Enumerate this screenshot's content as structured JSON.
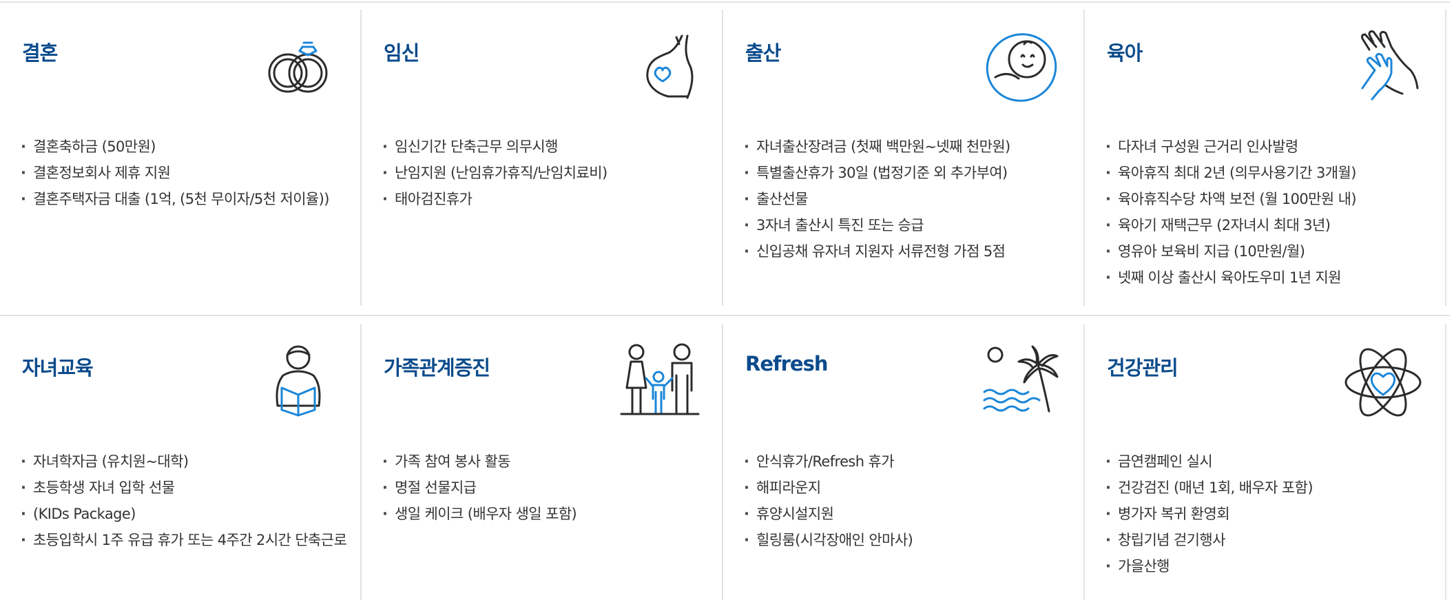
{
  "colors": {
    "title": "#0b4b8c",
    "accent": "#1a86d8",
    "icon_line": "#2b2b2b",
    "divider": "#e3e3e3"
  },
  "sections": [
    {
      "title": "결혼",
      "icon": "wedding-rings-icon",
      "items": [
        "결혼축하금 (50만원)",
        "결혼정보회사 제휴 지원",
        "결혼주택자금 대출 (1억, (5천 무이자/5천 저이율))"
      ]
    },
    {
      "title": "임신",
      "icon": "pregnancy-icon",
      "items": [
        "임신기간 단축근무 의무시행",
        "난임지원 (난임휴가휴직/난임치료비)",
        "태아검진휴가"
      ]
    },
    {
      "title": "출산",
      "icon": "newborn-baby-icon",
      "items": [
        "자녀출산장려금 (첫째 백만원~넷째 천만원)",
        "특별출산휴가 30일 (법정기준 외 추가부여)",
        "출산선물",
        "3자녀 출산시 특진 또는 승급",
        "신입공채 유자녀 지원자 서류전형 가점 5점"
      ]
    },
    {
      "title": "육아",
      "icon": "parent-child-hands-icon",
      "items": [
        "다자녀 구성원 근거리 인사발령",
        "육아휴직 최대 2년 (의무사용기간 3개월)",
        "육아휴직수당 차액 보전 (월 100만원 내)",
        "육아기 재택근무 (2자녀시 최대 3년)",
        "영유아 보육비 지급 (10만원/월)",
        "넷째 이상 출산시 육아도우미 1년 지원"
      ]
    },
    {
      "title": "자녀교육",
      "icon": "student-reading-icon",
      "items": [
        "자녀학자금 (유치원~대학)",
        "초등학생 자녀 입학 선물",
        "(KIDs Package)",
        "초등입학시 1주 유급 휴가 또는 4주간 2시간 단축근로"
      ]
    },
    {
      "title": "가족관계증진",
      "icon": "family-icon",
      "items": [
        "가족 참여 봉사 활동",
        "명절 선물지급",
        "생일 케이크 (배우자 생일 포함)"
      ]
    },
    {
      "title": "Refresh",
      "icon": "palm-beach-icon",
      "items": [
        "안식휴가/Refresh 휴가",
        "해피라운지",
        "휴양시설지원",
        "힐링룸(시각장애인 안마사)"
      ]
    },
    {
      "title": "건강관리",
      "icon": "health-heart-atom-icon",
      "items": [
        "금연캠페인 실시",
        "건강검진 (매년 1회, 배우자 포함)",
        "병가자 복귀 환영회",
        "창립기념 걷기행사",
        "가을산행"
      ]
    }
  ]
}
